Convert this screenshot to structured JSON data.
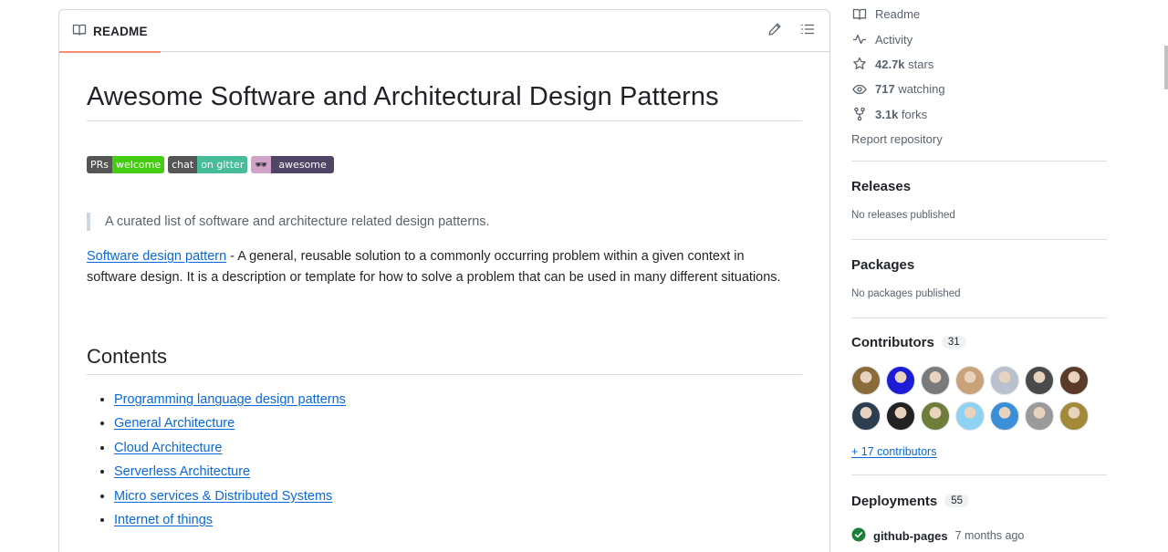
{
  "readme": {
    "tab_label": "README",
    "title": "Awesome Software and Architectural Design Patterns",
    "badges": [
      {
        "left": "PRs",
        "right": "welcome",
        "right_color": "#44cc11"
      },
      {
        "left": "chat",
        "right": "on gitter",
        "right_color": "#46bc99"
      },
      {
        "left": "🕶",
        "right": "awesome",
        "right_color": "#4d4466"
      }
    ],
    "quote": "A curated list of software and architecture related design patterns.",
    "intro_link": "Software design pattern",
    "intro_text_line1": " - A general, reusable solution to a commonly occurring problem within a given context in",
    "intro_text_rest": "software design. It is a description or template for how to solve a problem that can be used in many different situations.",
    "contents_heading": "Contents",
    "toc": [
      "Programming language design patterns",
      "General Architecture",
      "Cloud Architecture",
      "Serverless Architecture",
      "Micro services & Distributed Systems",
      "Internet of things"
    ]
  },
  "sidebar": {
    "meta": [
      {
        "icon": "book-icon",
        "bold": "",
        "text": "Readme"
      },
      {
        "icon": "pulse-icon",
        "bold": "",
        "text": "Activity"
      },
      {
        "icon": "star-icon",
        "bold": "42.7k",
        "text": " stars"
      },
      {
        "icon": "eye-icon",
        "bold": "717",
        "text": " watching"
      },
      {
        "icon": "fork-icon",
        "bold": "3.1k",
        "text": " forks"
      }
    ],
    "report": "Report repository",
    "releases": {
      "title": "Releases",
      "note": "No releases published"
    },
    "packages": {
      "title": "Packages",
      "note": "No packages published"
    },
    "contributors": {
      "title": "Contributors",
      "count": "31",
      "more": "+ 17 contributors",
      "avatars": [
        "#8a6b3a",
        "#1c1cd6",
        "#7a7a7a",
        "#c9a27a",
        "#b9c2cc",
        "#4a4a4a",
        "#5a3a28",
        "#2c3e50",
        "#222222",
        "#6f7d3a",
        "#8fd3f4",
        "#3a8fd6",
        "#9a9a9a",
        "#a38a3a"
      ]
    },
    "deployments": {
      "title": "Deployments",
      "count": "55",
      "env": "github-pages",
      "ago": "7 months ago"
    }
  }
}
